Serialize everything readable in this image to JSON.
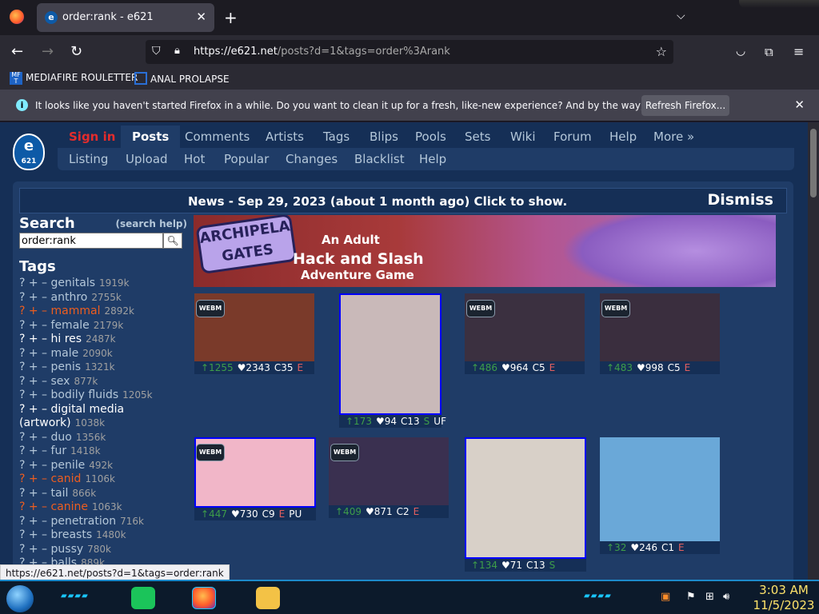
{
  "browser": {
    "tab_title": "order:rank - e621",
    "url_domain": "https://e621.net",
    "url_path": "/posts?d=1&tags=order%3Arank",
    "bookmarks": [
      "MEDIAFIRE ROULETTER",
      "ANAL PROLAPSE"
    ],
    "notification": "It looks like you haven't started Firefox in a while. Do you want to clean it up for a fresh, like-new experience? And by the way, welcome back!",
    "notification_button": "Refresh Firefox...",
    "status_url": "https://e621.net/posts?d=1&tags=order:rank"
  },
  "site": {
    "logo_text": "e",
    "logo_sub": "621",
    "main_nav": [
      "Sign in",
      "Posts",
      "Comments",
      "Artists",
      "Tags",
      "Blips",
      "Pools",
      "Sets",
      "Wiki",
      "Forum",
      "Help",
      "More »"
    ],
    "sub_nav": [
      "Listing",
      "Upload",
      "Hot",
      "Popular",
      "Changes",
      "Blacklist",
      "Help"
    ],
    "news": "News - Sep 29, 2023 (about 1 month ago) Click to show.",
    "dismiss": "Dismiss"
  },
  "sidebar": {
    "search_title": "Search",
    "search_help": "(search help)",
    "search_value": "order:rank",
    "tags_title": "Tags",
    "tags": [
      {
        "name": "genitals",
        "count": "1919k",
        "style": "normal"
      },
      {
        "name": "anthro",
        "count": "2755k",
        "style": "normal"
      },
      {
        "name": "mammal",
        "count": "2892k",
        "style": "red"
      },
      {
        "name": "female",
        "count": "2179k",
        "style": "normal"
      },
      {
        "name": "hi res",
        "count": "2487k",
        "style": "white"
      },
      {
        "name": "male",
        "count": "2090k",
        "style": "normal"
      },
      {
        "name": "penis",
        "count": "1321k",
        "style": "normal"
      },
      {
        "name": "sex",
        "count": "877k",
        "style": "normal"
      },
      {
        "name": "bodily fluids",
        "count": "1205k",
        "style": "normal"
      },
      {
        "name": "digital media",
        "count": "",
        "style": "white"
      },
      {
        "name": "(artwork)",
        "count": "1038k",
        "style": "white-cont"
      },
      {
        "name": "duo",
        "count": "1356k",
        "style": "normal"
      },
      {
        "name": "fur",
        "count": "1418k",
        "style": "normal"
      },
      {
        "name": "penile",
        "count": "492k",
        "style": "normal"
      },
      {
        "name": "canid",
        "count": "1106k",
        "style": "red"
      },
      {
        "name": "tail",
        "count": "866k",
        "style": "normal"
      },
      {
        "name": "canine",
        "count": "1063k",
        "style": "red"
      },
      {
        "name": "penetration",
        "count": "716k",
        "style": "normal"
      },
      {
        "name": "breasts",
        "count": "1480k",
        "style": "normal"
      },
      {
        "name": "pussy",
        "count": "780k",
        "style": "normal"
      },
      {
        "name": "balls",
        "count": "889k",
        "style": "normal"
      }
    ]
  },
  "ad": {
    "logo": "ARCHIPELA GATES",
    "line1": "An Adult",
    "line2": "Hack and Slash",
    "line3": "Adventure Game"
  },
  "posts": [
    {
      "up": "↑1255",
      "fav": "♥2343",
      "c": "C35",
      "r": "E",
      "extra": "",
      "webm": true,
      "color": "#7a3a2a"
    },
    {
      "up": "↑173",
      "fav": "♥94",
      "c": "C13",
      "r": "S",
      "extra": "UF",
      "webm": false,
      "color": "#c9b9b9"
    },
    {
      "up": "↑486",
      "fav": "♥964",
      "c": "C5",
      "r": "E",
      "extra": "",
      "webm": true,
      "color": "#3b3040"
    },
    {
      "up": "↑483",
      "fav": "♥998",
      "c": "C5",
      "r": "E",
      "extra": "",
      "webm": true,
      "color": "#3a2e3e"
    },
    {
      "up": "↑447",
      "fav": "♥730",
      "c": "C9",
      "r": "E",
      "extra": "PU",
      "webm": true,
      "color": "#f1b6c8"
    },
    {
      "up": "↑409",
      "fav": "♥871",
      "c": "C2",
      "r": "E",
      "extra": "",
      "webm": true,
      "color": "#3a3050"
    },
    {
      "up": "↑134",
      "fav": "♥71",
      "c": "C13",
      "r": "S",
      "extra": "",
      "webm": false,
      "color": "#d8d0c8"
    },
    {
      "up": "↑32",
      "fav": "♥246",
      "c": "C1",
      "r": "E",
      "extra": "",
      "webm": false,
      "color": "#6aa8d8"
    }
  ],
  "webm_label": "WEBM",
  "taskbar": {
    "time": "3:03 AM",
    "date": "11/5/2023"
  }
}
